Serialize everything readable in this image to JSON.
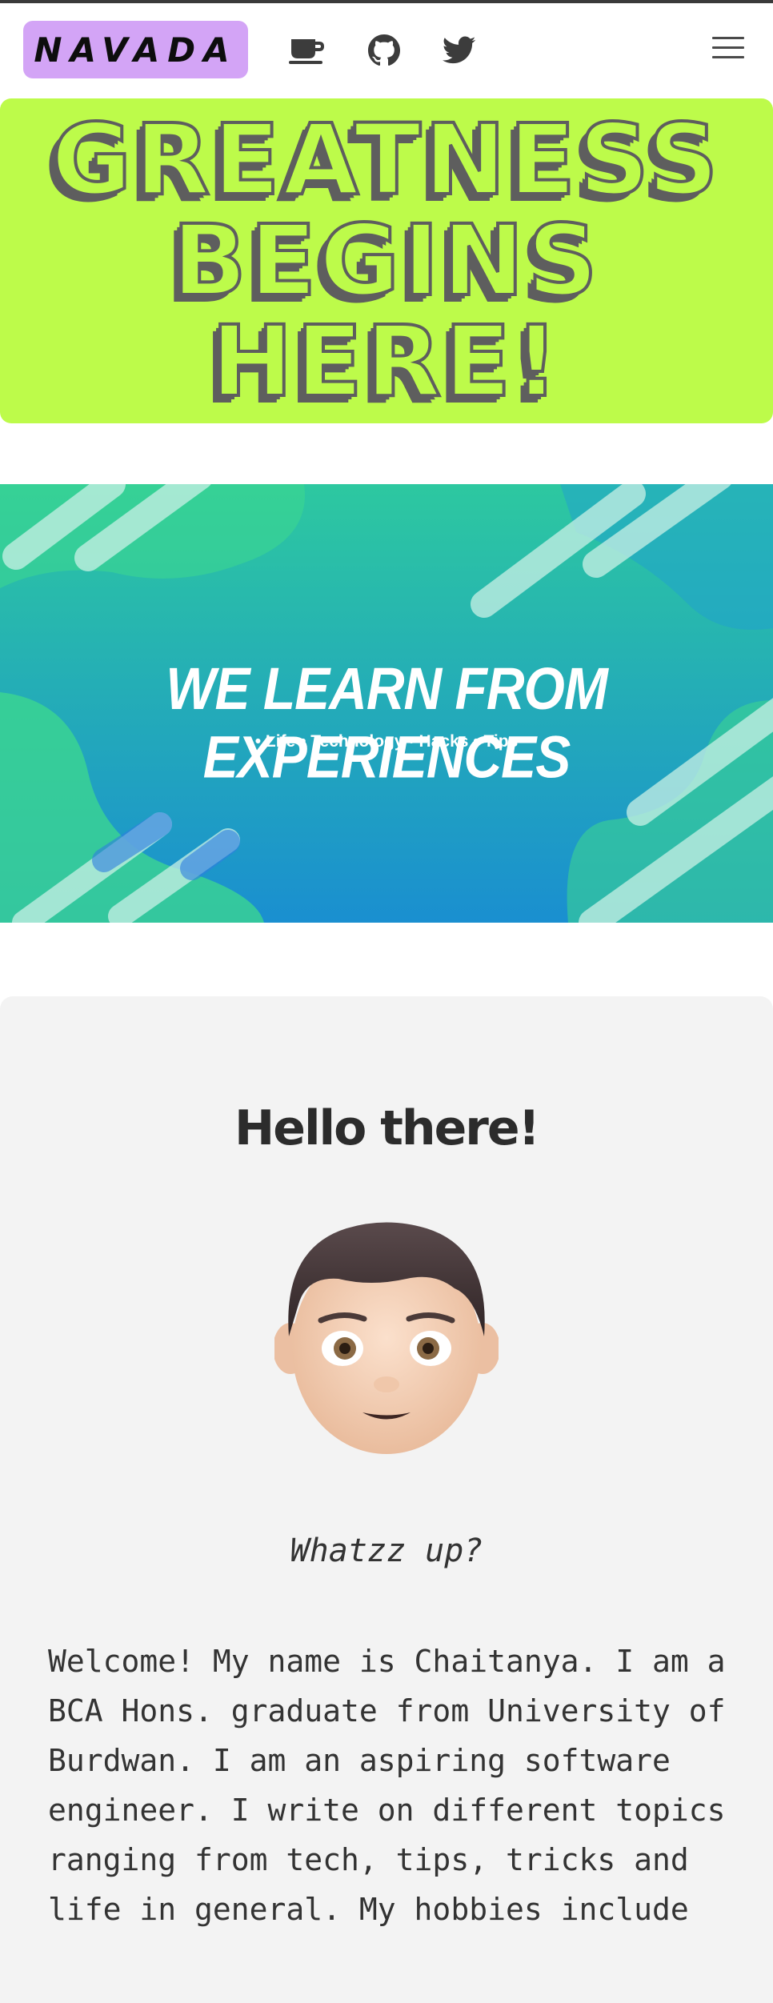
{
  "header": {
    "brand": "NAVADA",
    "icons": [
      "coffee-icon",
      "github-icon",
      "twitter-icon",
      "hamburger-menu-icon"
    ]
  },
  "hero": {
    "lines": [
      "GREATNESS",
      "BEGINS",
      "HERE!"
    ],
    "colors": {
      "background": "#bdfb4a",
      "text_outline": "#5e5e5e"
    }
  },
  "banner": {
    "title": "WE LEARN FROM EXPERIENCES",
    "subtitle": "• Life • Technology • Hacks • Tips"
  },
  "about": {
    "title": "Hello there!",
    "avatar": "boy-emoji-avatar",
    "tagline": "Whatzz up?",
    "body": "Welcome! My name is Chaitanya. I am a BCA Hons. graduate from University of Burdwan. I am an aspiring software engineer. I write on different topics ranging from tech, tips, tricks and life in general. My hobbies include"
  },
  "colors": {
    "brand_bg": "#d3a4f6",
    "card_bg": "#f3f3f3",
    "banner_top": "#2dc8a0",
    "banner_bottom": "#1a8fd0"
  }
}
